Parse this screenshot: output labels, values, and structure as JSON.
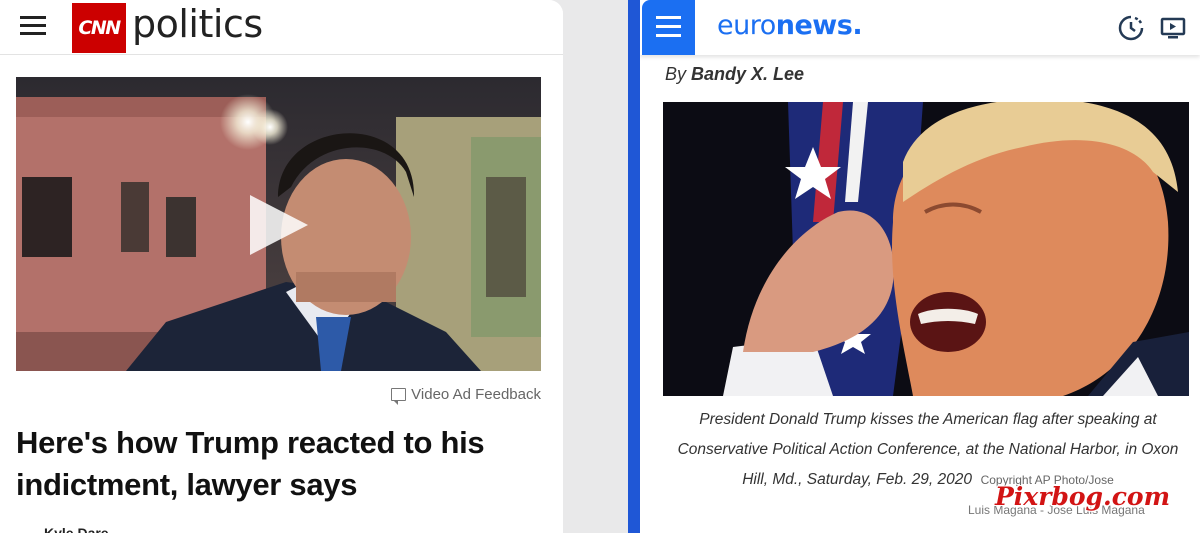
{
  "cnn": {
    "logo_text": "CNN",
    "section_title": "politics",
    "ad_feedback_label": "Video Ad Feedback",
    "headline": "Here's how Trump reacted to his indictment, lawyer says",
    "author": "Kyle Dare...",
    "colors": {
      "brand": "#cc0000"
    }
  },
  "euronews": {
    "logo_light": "euro",
    "logo_bold": "news",
    "logo_dot": ".",
    "byline_prefix": "By",
    "byline_author": "Bandy X. Lee",
    "caption": "President Donald Trump kisses the American flag after speaking at Conservative Political Action Conference, at the National Harbor, in Oxon Hill, Md., Saturday, Feb. 29, 2020",
    "copyright": "Copyright  AP Photo/Jose",
    "credit_line2": "Luis Magana  -  Jose Luis Magana",
    "colors": {
      "brand": "#1b6ff2",
      "border": "#1f57d6"
    }
  },
  "watermark": "Pixrbog.com"
}
